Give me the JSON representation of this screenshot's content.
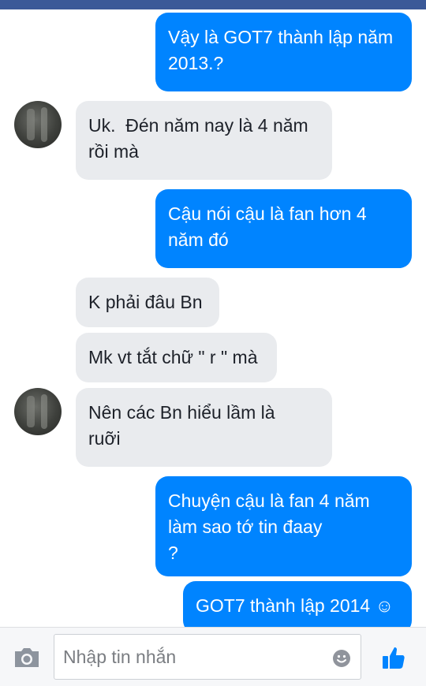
{
  "colors": {
    "accent": "#0084ff",
    "incoming": "#e9ebee",
    "header": "#3b5998"
  },
  "messages": [
    {
      "side": "out",
      "text": "Vậy là GOT7 thành lập năm\n2013.?"
    },
    {
      "side": "in",
      "text": "Uk.  Đén năm nay là 4 năm\nrồi mà"
    },
    {
      "side": "out",
      "text": "Cậu nói cậu là fan hơn 4\nnăm đó"
    },
    {
      "side": "in",
      "text": "K phải đâu Bn"
    },
    {
      "side": "in",
      "text": "Mk vt tắt chữ \" r \" mà"
    },
    {
      "side": "in",
      "text": "Nên các Bn hiểu lầm là\nruỡi"
    },
    {
      "side": "out",
      "text": "Chuyện cậu là fan 4 năm\nlàm sao tớ tin đaay\n?"
    },
    {
      "side": "out",
      "text": "GOT7 thành lập 2014 ☺"
    }
  ],
  "composer": {
    "placeholder": "Nhập tin nhắn",
    "camera_icon": "camera-icon",
    "emoji_icon": "emoji-icon",
    "like_icon": "thumbs-up-icon"
  }
}
